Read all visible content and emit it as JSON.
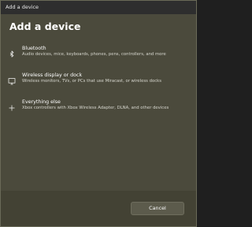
{
  "window": {
    "title": "Add a device"
  },
  "main": {
    "heading": "Add a device",
    "options": [
      {
        "icon": "bluetooth-icon",
        "title": "Bluetooth",
        "description": "Audio devices, mice, keyboards, phones, pens, controllers, and more"
      },
      {
        "icon": "monitor-icon",
        "title": "Wireless display or dock",
        "description": "Wireless monitors, TVs, or PCs that use Miracast, or wireless docks"
      },
      {
        "icon": "plus-icon",
        "title": "Everything else",
        "description": "Xbox controllers with Xbox Wireless Adapter, DLNA, and other devices"
      }
    ]
  },
  "footer": {
    "cancel_label": "Cancel"
  },
  "colors": {
    "background": "#4b4a3c",
    "footer": "#434234",
    "titlebar": "#2e2e2e",
    "button": "#5c5b4c",
    "text": "#ffffff"
  }
}
